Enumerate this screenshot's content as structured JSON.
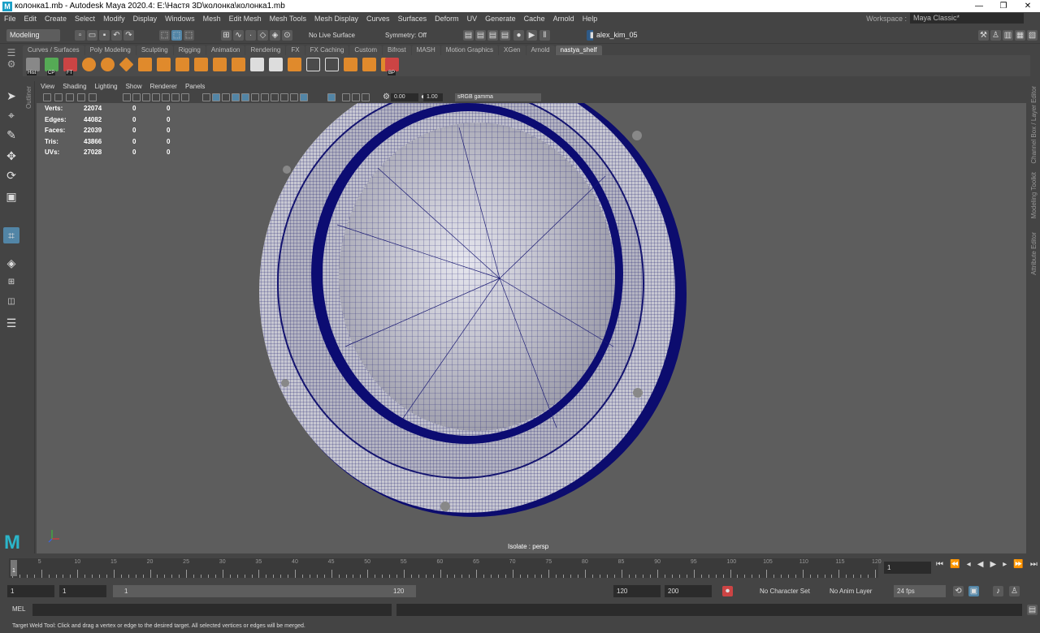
{
  "window": {
    "title": "колонка1.mb - Autodesk Maya 2020.4: E:\\Настя 3D\\колонка\\колонка1.mb",
    "minimize": "—",
    "maximize": "❐",
    "close": "✕"
  },
  "menu": [
    "File",
    "Edit",
    "Create",
    "Select",
    "Modify",
    "Display",
    "Windows",
    "Mesh",
    "Edit Mesh",
    "Mesh Tools",
    "Mesh Display",
    "Curves",
    "Surfaces",
    "Deform",
    "UV",
    "Generate",
    "Cache",
    "Arnold",
    "Help"
  ],
  "workspace": {
    "label": "Workspace :",
    "value": "Maya Classic*"
  },
  "statusline": {
    "mode": "Modeling",
    "live_surface": "No Live Surface",
    "symmetry": "Symmetry: Off",
    "user": "alex_kim_05"
  },
  "shelf_tabs": [
    "Curves / Surfaces",
    "Poly Modeling",
    "Sculpting",
    "Rigging",
    "Animation",
    "Rendering",
    "FX",
    "FX Caching",
    "Custom",
    "Bifrost",
    "MASH",
    "Motion Graphics",
    "XGen",
    "Arnold",
    "nastya_shelf"
  ],
  "shelf_active": "nastya_shelf",
  "shelf_labels": {
    "hist": "Hist",
    "cp": "CP",
    "ft": "FT",
    "bp": "BP"
  },
  "outliner_label": "Outliner",
  "panel_menu": [
    "View",
    "Shading",
    "Lighting",
    "Show",
    "Renderer",
    "Panels"
  ],
  "panel_tools": {
    "exposure": "0.00",
    "gamma": "1.00",
    "colorspace": "sRGB gamma"
  },
  "hud": {
    "rows": [
      {
        "label": "Verts:",
        "value": "22074",
        "sel": "0",
        "comp": "0"
      },
      {
        "label": "Edges:",
        "value": "44082",
        "sel": "0",
        "comp": "0"
      },
      {
        "label": "Faces:",
        "value": "22039",
        "sel": "0",
        "comp": "0"
      },
      {
        "label": "Tris:",
        "value": "43866",
        "sel": "0",
        "comp": "0"
      },
      {
        "label": "UVs:",
        "value": "27028",
        "sel": "0",
        "comp": "0"
      }
    ]
  },
  "viewport_label": "Isolate : persp",
  "right_tabs": [
    "Channel Box / Layer Editor",
    "Modeling Toolkit",
    "Attribute Editor"
  ],
  "timeline": {
    "ticks": [
      "1",
      "5",
      "10",
      "15",
      "20",
      "25",
      "30",
      "35",
      "40",
      "45",
      "50",
      "55",
      "60",
      "65",
      "70",
      "75",
      "80",
      "85",
      "90",
      "95",
      "100",
      "105",
      "110",
      "115",
      "120"
    ],
    "current": "1"
  },
  "range": {
    "start": "1",
    "playback_start": "1",
    "slider_start": "1",
    "slider_end": "120",
    "playback_end": "120",
    "end": "200",
    "character_set": "No Character Set",
    "anim_layer": "No Anim Layer",
    "fps": "24 fps"
  },
  "mel_label": "MEL",
  "help_text": "Target Weld Tool: Click and drag a vertex or edge to the desired target. All selected vertices or edges will be merged."
}
